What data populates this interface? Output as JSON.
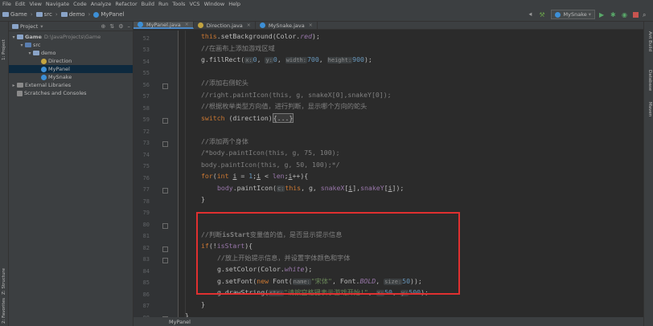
{
  "menu": [
    "File",
    "Edit",
    "View",
    "Navigate",
    "Code",
    "Analyze",
    "Refactor",
    "Build",
    "Run",
    "Tools",
    "VCS",
    "Window",
    "Help"
  ],
  "breadcrumb": [
    "Game",
    "src",
    "demo",
    "MyPanel"
  ],
  "run_config": "MySnake",
  "left_strip": {
    "project": "1: Project",
    "structure": "Z: Structure",
    "favorites": "2: Favorites"
  },
  "right_strip": {
    "ant": "Ant Build",
    "database": "Database",
    "maven": "Maven"
  },
  "project_panel": {
    "title": "Project",
    "tree": [
      {
        "label": "Game",
        "path": "D:\\JavaProjects\\Game"
      },
      {
        "label": "src"
      },
      {
        "label": "demo"
      },
      {
        "label": "Direction"
      },
      {
        "label": "MyPanel"
      },
      {
        "label": "MySnake"
      },
      {
        "label": "External Libraries"
      },
      {
        "label": "Scratches and Consoles"
      }
    ]
  },
  "tabs": [
    {
      "label": "MyPanel.java"
    },
    {
      "label": "Direction.java"
    },
    {
      "label": "MySnake.java"
    }
  ],
  "line_numbers": [
    "52",
    "53",
    "54",
    "55",
    "56",
    "57",
    "58",
    "59",
    "72",
    "73",
    "74",
    "75",
    "76",
    "77",
    "78",
    "79",
    "80",
    "81",
    "82",
    "83",
    "84",
    "85",
    "86",
    "87",
    "88",
    "89"
  ],
  "code": {
    "l52a": "this",
    "l52b": ".setBackground(Color.",
    "l52c": "red",
    "l52d": ");",
    "l53": "//在画布上添加游戏区域",
    "l54a": "g.fillRect(",
    "l54h1": "x:",
    "l54v1": "0",
    "l54h2": "y:",
    "l54v2": "0",
    "l54h3": "width:",
    "l54v3": "700",
    "l54h4": "height:",
    "l54v4": "900",
    "l54e": ");",
    "l56": "//添加右侧蛇头",
    "l57": "//right.paintIcon(this, g, snakeX[0],snakeY[0]);",
    "l58": "//根据枚举类型方向值，进行判断，显示哪个方向的蛇头",
    "l59a": "switch",
    "l59b": " (direction)",
    "l59c": "{...}",
    "l73": "//添加两个身体",
    "l74": "/*body.paintIcon(this, g, 75, 100);",
    "l75": "body.paintIcon(this, g, 50, 100);*/",
    "l76a": "for",
    "l76b": "(",
    "l76c": "int",
    "l76d": " ",
    "l76e": "i",
    "l76f": " = ",
    "l76g": "1",
    "l76h": ";",
    "l76i": "i",
    "l76j": " < ",
    "l76k": "len",
    "l76l": ";",
    "l76m": "i",
    "l76n": "++){",
    "l77a": "body",
    "l77b": ".paintIcon(",
    "l77h": "c:",
    "l77c": "this",
    "l77d": ", g, ",
    "l77e": "snakeX",
    "l77f": "[",
    "l77g": "i",
    "l77i": "],",
    "l77j": "snakeY",
    "l77k": "[",
    "l77l": "i",
    "l77m": "]);",
    "l78": "}",
    "l81a": "//判断",
    "l81b": "isStart",
    "l81c": "变量值的值，是否显示提示信息",
    "l82a": "if",
    "l82b": "(!",
    "l82c": "isStart",
    "l82d": "){",
    "l83": "//放上开始提示信息，并设置字体颜色和字体",
    "l84a": "g.setColor(Color.",
    "l84b": "white",
    "l84c": ");",
    "l85a": "g.setFont(",
    "l85b": "new",
    "l85c": " Font(",
    "l85h1": "name:",
    "l85d": "\"宋体\"",
    "l85e": ", Font.",
    "l85f": "BOLD",
    "l85g": ",",
    "l85h2": "size:",
    "l85i": "50",
    "l85j": "));",
    "l86a": "g.drawString(",
    "l86h1": "str:",
    "l86b": "\"请按空格键表示游戏开始!\"",
    "l86c": ",",
    "l86h2": "x:",
    "l86d": "50",
    "l86e": ",",
    "l86h3": "y:",
    "l86f": "500",
    "l86g": ");",
    "l87": "}",
    "l88": "}"
  },
  "status_file": "MyPanel",
  "colors": {
    "highlight_box": "#e03030",
    "keyword": "#cc7832",
    "comment": "#808080",
    "field": "#9876aa",
    "number": "#6897bb",
    "string": "#6a8759"
  }
}
